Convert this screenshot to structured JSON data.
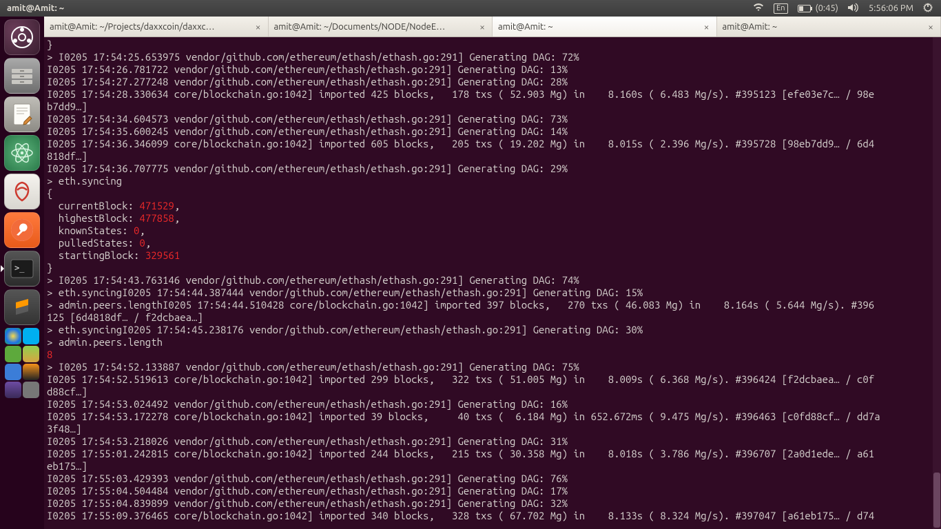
{
  "panel": {
    "title": "amit@Amit: ~",
    "lang": "En",
    "battery": "(0:45)",
    "time": "5:56:06 PM"
  },
  "tabs": [
    {
      "label": "amit@Amit: ~/Projects/daxxcoin/daxxc…",
      "active": false
    },
    {
      "label": "amit@Amit: ~/Documents/NODE/NodeE…",
      "active": false
    },
    {
      "label": "amit@Amit: ~",
      "active": true
    },
    {
      "label": "amit@Amit: ~",
      "active": false
    }
  ],
  "sync": {
    "currentBlock": "471529",
    "highestBlock": "477858",
    "knownStates": "0",
    "pulledStates": "0",
    "startingBlock": "329561"
  },
  "peersLengthResult": "8",
  "lines": {
    "l00": "}",
    "l01": "> I0205 17:54:25.653975 vendor/github.com/ethereum/ethash/ethash.go:291] Generating DAG: 72%",
    "l02": "I0205 17:54:26.781722 vendor/github.com/ethereum/ethash/ethash.go:291] Generating DAG: 13%",
    "l03": "I0205 17:54:27.277248 vendor/github.com/ethereum/ethash/ethash.go:291] Generating DAG: 28%",
    "l04": "I0205 17:54:28.330634 core/blockchain.go:1042] imported 425 blocks,   178 txs ( 52.903 Mg) in    8.160s ( 6.483 Mg/s). #395123 [efe03e7c… / 98e",
    "l05": "b7dd9…]",
    "l06": "I0205 17:54:34.604573 vendor/github.com/ethereum/ethash/ethash.go:291] Generating DAG: 73%",
    "l07": "I0205 17:54:35.600245 vendor/github.com/ethereum/ethash/ethash.go:291] Generating DAG: 14%",
    "l08": "I0205 17:54:36.346099 core/blockchain.go:1042] imported 605 blocks,   205 txs ( 19.202 Mg) in    8.015s ( 2.396 Mg/s). #395728 [98eb7dd9… / 6d4",
    "l09": "818df…]",
    "l10": "I0205 17:54:36.707775 vendor/github.com/ethereum/ethash/ethash.go:291] Generating DAG: 29%",
    "l11": "> eth.syncing",
    "l12": "{",
    "l13a": "  currentBlock: ",
    "l13c": ",",
    "l14a": "  highestBlock: ",
    "l14c": ",",
    "l15a": "  knownStates: ",
    "l15c": ",",
    "l16a": "  pulledStates: ",
    "l16c": ",",
    "l17a": "  startingBlock: ",
    "l18": "}",
    "l19": "> I0205 17:54:43.763146 vendor/github.com/ethereum/ethash/ethash.go:291] Generating DAG: 74%",
    "l20": "> eth.syncingI0205 17:54:44.387444 vendor/github.com/ethereum/ethash/ethash.go:291] Generating DAG: 15%",
    "l21": "> admin.peers.lengthI0205 17:54:44.510428 core/blockchain.go:1042] imported 397 blocks,   270 txs ( 46.083 Mg) in    8.164s ( 5.644 Mg/s). #396",
    "l22": "125 [6d4818df… / f2dcbaea…]",
    "l23": "> eth.syncingI0205 17:54:45.238176 vendor/github.com/ethereum/ethash/ethash.go:291] Generating DAG: 30%",
    "l24": "> admin.peers.length",
    "l26": "> I0205 17:54:52.133887 vendor/github.com/ethereum/ethash/ethash.go:291] Generating DAG: 75%",
    "l27": "I0205 17:54:52.519613 core/blockchain.go:1042] imported 299 blocks,   322 txs ( 51.005 Mg) in    8.009s ( 6.368 Mg/s). #396424 [f2dcbaea… / c0f",
    "l28": "d88cf…]",
    "l29": "I0205 17:54:53.024492 vendor/github.com/ethereum/ethash/ethash.go:291] Generating DAG: 16%",
    "l30": "I0205 17:54:53.172278 core/blockchain.go:1042] imported 39 blocks,     40 txs (  6.184 Mg) in 652.672ms ( 9.475 Mg/s). #396463 [c0fd88cf… / dd7a",
    "l31": "3f48…]",
    "l32": "I0205 17:54:53.218026 vendor/github.com/ethereum/ethash/ethash.go:291] Generating DAG: 31%",
    "l33": "I0205 17:55:01.242815 core/blockchain.go:1042] imported 244 blocks,   215 txs ( 30.358 Mg) in    8.018s ( 3.786 Mg/s). #396707 [2a0d1ede… / a61",
    "l34": "eb175…]",
    "l35": "I0205 17:55:03.429393 vendor/github.com/ethereum/ethash/ethash.go:291] Generating DAG: 76%",
    "l36": "I0205 17:55:04.504484 vendor/github.com/ethereum/ethash/ethash.go:291] Generating DAG: 17%",
    "l37": "I0205 17:55:04.839899 vendor/github.com/ethereum/ethash/ethash.go:291] Generating DAG: 32%",
    "l38": "I0205 17:55:09.376465 core/blockchain.go:1042] imported 340 blocks,   328 txs ( 67.702 Mg) in    8.133s ( 8.324 Mg/s). #397047 [a61eb175… / d74"
  }
}
